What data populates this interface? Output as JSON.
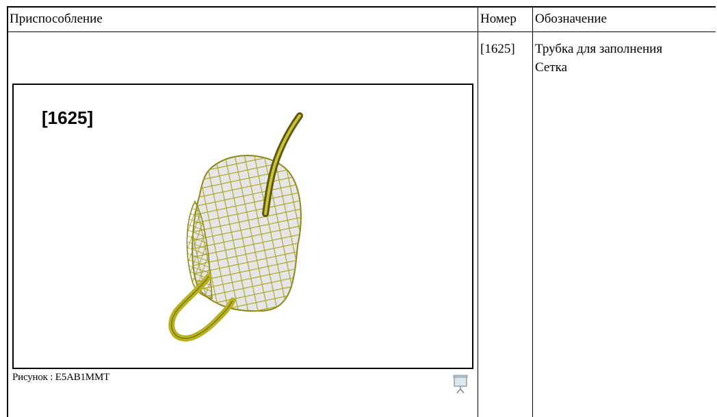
{
  "table": {
    "headers": {
      "fixture": "Приспособление",
      "number": "Номер",
      "designation": "Обозначение"
    },
    "rows": [
      {
        "number": "[1625]",
        "designation_lines": [
          "Трубка для заполнения",
          "Сетка"
        ]
      }
    ]
  },
  "figure": {
    "callout": "[1625]",
    "caption": "Рисунок : E5AB1MMT",
    "image_subject": "filling-tube-and-mesh-illustration",
    "colors": {
      "mesh": "#a8a21c",
      "mesh_dark": "#6e6a10",
      "bag": "#e4e4e4"
    }
  },
  "icons": {
    "presentation": "presentation-view-icon"
  }
}
